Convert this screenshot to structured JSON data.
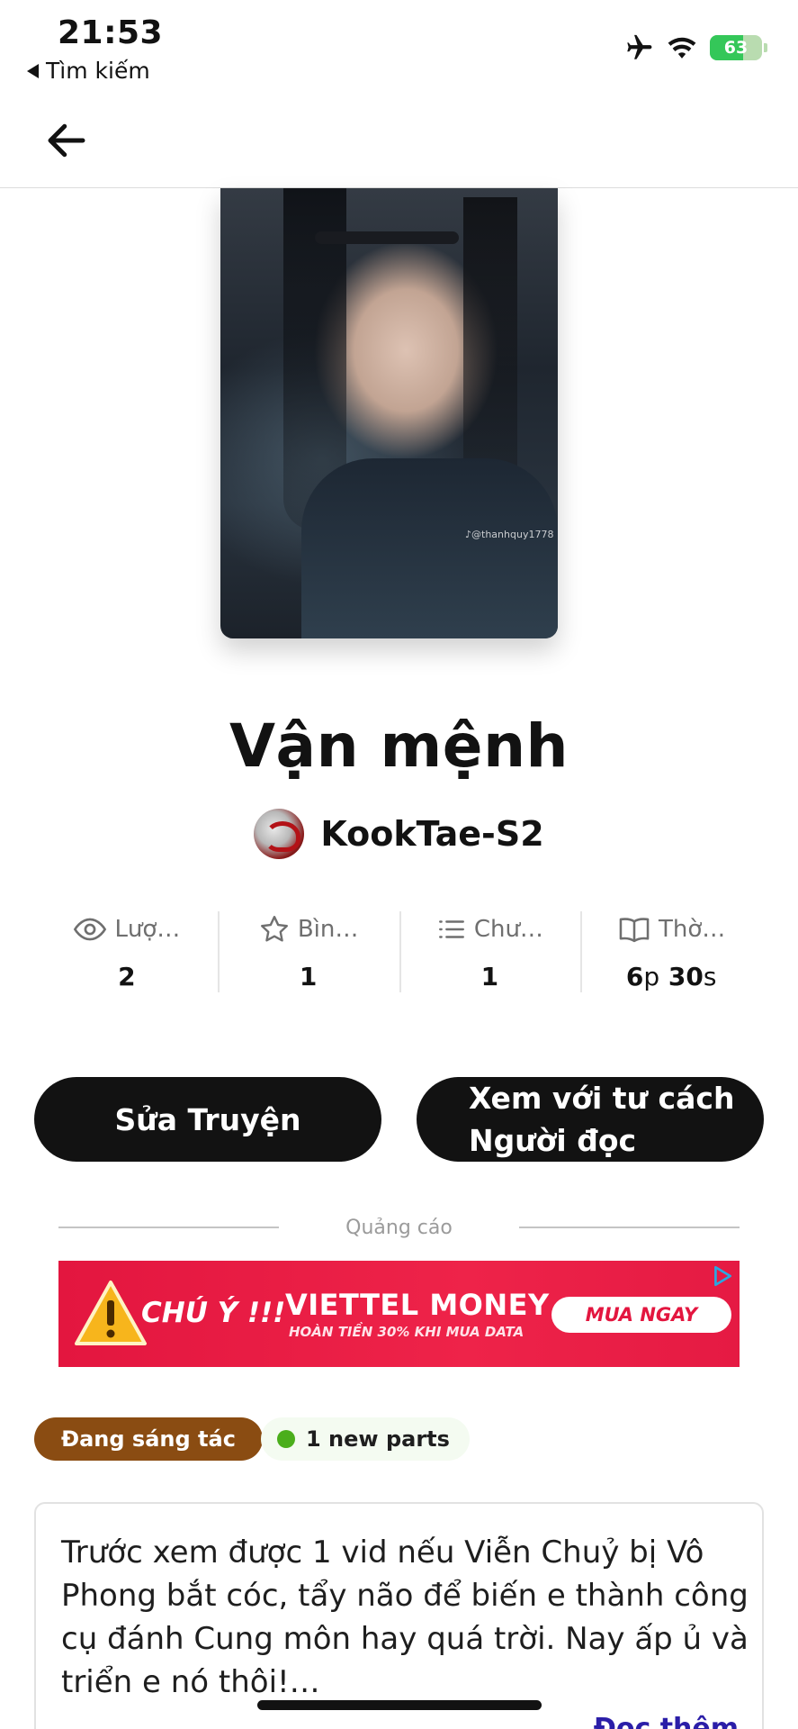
{
  "status_bar": {
    "time": "21:53",
    "back_label": "Tìm kiếm",
    "battery": "63",
    "icons": [
      "airplane-icon",
      "wifi-icon",
      "battery-icon"
    ]
  },
  "nav": {
    "back_icon": "arrow-left-icon"
  },
  "cover": {
    "watermark": "♪@thanhquy1778"
  },
  "story": {
    "title": "Vận mệnh",
    "author": "KookTae-S2"
  },
  "stats": [
    {
      "icon": "eye-icon",
      "label": "Lượ…",
      "value": "2"
    },
    {
      "icon": "star-icon",
      "label": "Bìn…",
      "value": "1"
    },
    {
      "icon": "list-icon",
      "label": "Chư…",
      "value": "1"
    },
    {
      "icon": "book-icon",
      "label": "Thờ…",
      "value_num1": "6",
      "value_unit1": "p",
      "value_num2": "30",
      "value_unit2": "s"
    }
  ],
  "buttons": {
    "edit": "Sửa Truyện",
    "reader_line1": "Xem với tư cách",
    "reader_line2": "Người đọc"
  },
  "ad": {
    "label": "Quảng cáo",
    "alert": "CHÚ Ý !!!",
    "brand": "VIETTEL MONEY",
    "subtitle": "HOÀN TIỀN 30% KHI MUA DATA",
    "cta": "MUA NGAY"
  },
  "tags": {
    "status": "Đang sáng tác",
    "new_parts": "1 new parts"
  },
  "description": {
    "text": "Trước xem được 1 vid nếu Viễn Chuỷ bị Vô Phong bắt cóc, tẩy não để biến e thành công cụ đánh Cung môn hay quá trời. Nay ấp ủ và triển e nó thôi!…",
    "read_more": "Đọc thêm"
  },
  "colors": {
    "primary": "#121212",
    "status_tag": "#8a4c12",
    "new_dot": "#4bae1c",
    "ad_red": "#e3163f",
    "link": "#2b1ea8"
  }
}
